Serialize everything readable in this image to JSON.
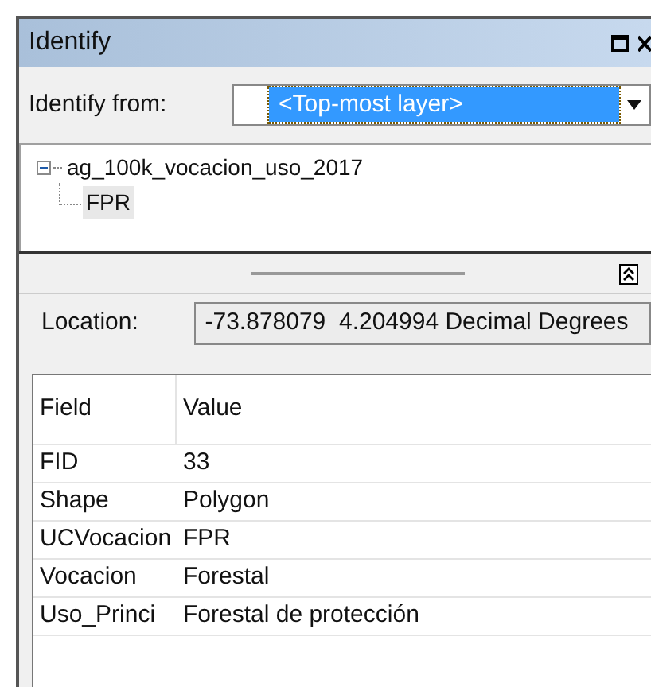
{
  "window": {
    "title": "Identify"
  },
  "identify_from": {
    "label": "Identify from:",
    "value": "<Top-most layer>"
  },
  "tree": [
    {
      "label": "ag_100k_vocacion_uso_2017",
      "expanded": true,
      "children": [
        {
          "label": "FPR",
          "selected": true
        }
      ]
    }
  ],
  "location": {
    "label": "Location:",
    "value": "-73.878079  4.204994 Decimal Degrees"
  },
  "table": {
    "columns": [
      "Field",
      "Value"
    ],
    "rows": [
      [
        "FID",
        "33"
      ],
      [
        "Shape",
        "Polygon"
      ],
      [
        "UCVocacion",
        "FPR"
      ],
      [
        "Vocacion",
        "Forestal"
      ],
      [
        "Uso_Princi",
        "Forestal de protección"
      ]
    ]
  }
}
